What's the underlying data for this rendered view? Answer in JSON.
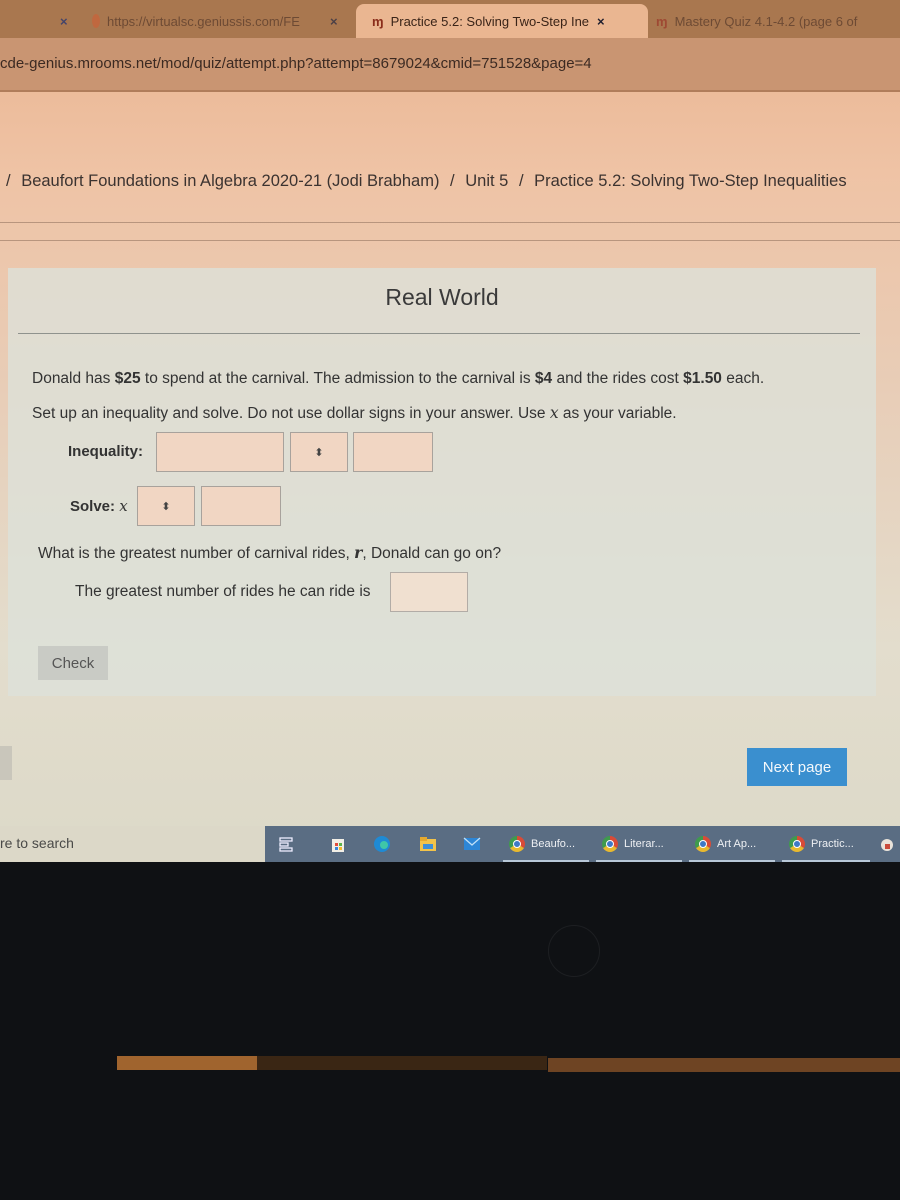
{
  "browser": {
    "tabs": [
      {
        "label": "https://virtualsc.geniussis.com/FE",
        "close": "×",
        "active": false
      },
      {
        "label": "Practice 5.2: Solving Two-Step Ine",
        "close": "×",
        "active": true
      },
      {
        "label": "Mastery Quiz 4.1-4.2 (page 6 of",
        "active": false
      }
    ],
    "url": "cde-genius.mrooms.net/mod/quiz/attempt.php?attempt=8679024&cmid=751528&page=4"
  },
  "breadcrumb": {
    "items": [
      "Beaufort Foundations in Algebra 2020-21 (Jodi Brabham)",
      "Unit 5",
      "Practice 5.2: Solving Two-Step Inequalities"
    ],
    "separator": "/"
  },
  "question": {
    "title": "Real World",
    "text_parts": [
      "Donald has ",
      "$25",
      " to spend at the carnival. The admission to the carnival is ",
      "$4",
      " and the rides cost ",
      "$1.50",
      " each."
    ],
    "instruction_parts": [
      "Set up an inequality and solve. Do not use dollar signs in your answer. Use ",
      "x",
      " as your variable."
    ],
    "inequality_label": "Inequality:",
    "inequality_left_value": "",
    "inequality_operator_value": "",
    "inequality_right_value": "",
    "select_arrow": "⬍",
    "solve_label": "Solve:",
    "solve_var": "x",
    "solve_operator_value": "",
    "solve_value": "",
    "rides_question_parts": [
      "What is the greatest number of carnival rides, ",
      "r",
      ", Donald can go on?"
    ],
    "rides_answer_label": "The greatest number of rides he can ride is",
    "rides_answer_value": "",
    "check_label": "Check"
  },
  "navigation": {
    "next_label": "Next page"
  },
  "taskbar": {
    "search_placeholder": "re to search",
    "apps": [
      {
        "label": "Beaufo..."
      },
      {
        "label": "Literar..."
      },
      {
        "label": "Art Ap..."
      },
      {
        "label": "Practic..."
      }
    ]
  },
  "colors": {
    "accent": "#3a8fcf",
    "taskbar": "#5a6d83"
  }
}
